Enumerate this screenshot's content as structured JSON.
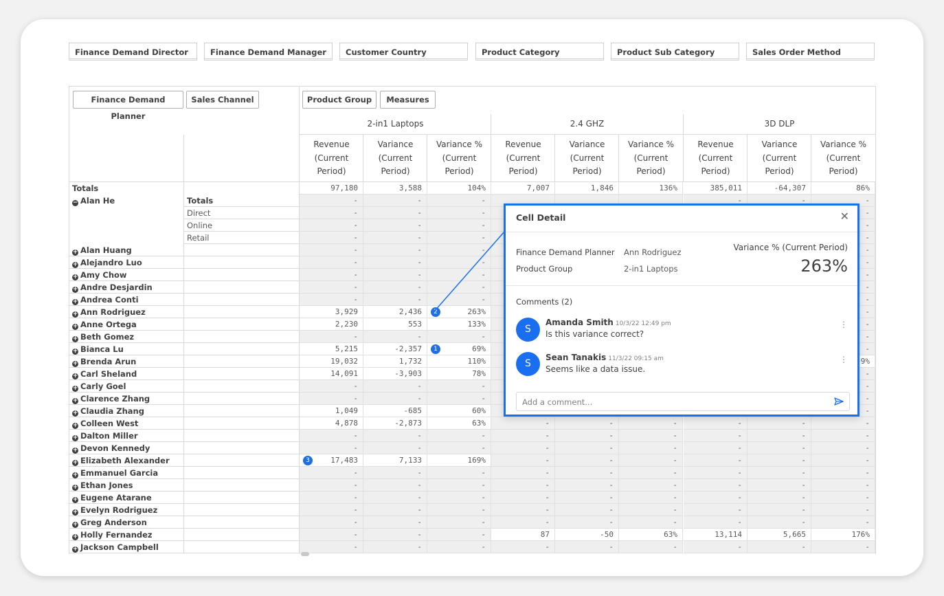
{
  "filters": [
    "Finance Demand Director",
    "Finance Demand Manager",
    "Customer Country",
    "Product Category",
    "Product Sub Category",
    "Sales Order Method"
  ],
  "dimension_buttons": {
    "planner": "Finance Demand Planner",
    "channel": "Sales Channel",
    "group": "Product Group",
    "measures": "Measures"
  },
  "product_groups": [
    "2-in1 Laptops",
    "2.4 GHZ",
    "3D DLP"
  ],
  "measure_header": [
    "Revenue (Current Period)",
    "Variance (Current Period)",
    "Variance % (Current Period)"
  ],
  "measure_lines": [
    [
      "Revenue",
      "(Current",
      "Period)"
    ],
    [
      "Variance",
      "(Current",
      "Period)"
    ],
    [
      "Variance %",
      "(Current",
      "Period)"
    ]
  ],
  "totals": {
    "label": "Totals",
    "values": [
      "97,180",
      "3,588",
      "104%",
      "7,007",
      "1,846",
      "136%",
      "385,011",
      "-64,307",
      "86%"
    ]
  },
  "rows": [
    {
      "name": "Alan He",
      "sub": "Totals",
      "sub_bold": true,
      "expanded": true,
      "vals": [
        "-",
        "-",
        "-",
        "",
        "",
        "",
        "-",
        "-",
        "-"
      ],
      "white": []
    },
    {
      "name": "",
      "sub": "Direct",
      "vals": [
        "-",
        "-",
        "-",
        "",
        "",
        "",
        "",
        "",
        "-"
      ],
      "white": []
    },
    {
      "name": "",
      "sub": "Online",
      "vals": [
        "-",
        "-",
        "-",
        "",
        "",
        "",
        "",
        "",
        "-"
      ],
      "white": []
    },
    {
      "name": "",
      "sub": "Retail",
      "vals": [
        "-",
        "-",
        "-",
        "",
        "",
        "",
        "",
        "",
        "-"
      ],
      "white": []
    },
    {
      "name": "Alan Huang",
      "vals": [
        "-",
        "-",
        "-",
        "",
        "",
        "",
        "",
        "",
        "-"
      ],
      "white": []
    },
    {
      "name": "Alejandro Luo",
      "vals": [
        "-",
        "-",
        "-",
        "",
        "",
        "",
        "",
        "",
        "-"
      ],
      "white": []
    },
    {
      "name": "Amy Chow",
      "vals": [
        "-",
        "-",
        "-",
        "",
        "",
        "",
        "",
        "",
        "-"
      ],
      "white": []
    },
    {
      "name": "Andre Desjardin",
      "vals": [
        "-",
        "-",
        "-",
        "",
        "",
        "",
        "",
        "",
        "-"
      ],
      "white": []
    },
    {
      "name": "Andrea Conti",
      "vals": [
        "-",
        "-",
        "-",
        "",
        "",
        "",
        "",
        "",
        "-"
      ],
      "white": []
    },
    {
      "name": "Ann Rodriguez",
      "vals": [
        "3,929",
        "2,436",
        "263%",
        "",
        "",
        "",
        "",
        "",
        "-"
      ],
      "white": [
        0,
        1,
        2
      ],
      "badge": {
        "col": 2,
        "num": "2"
      }
    },
    {
      "name": "Anne Ortega",
      "vals": [
        "2,230",
        "553",
        "133%",
        "",
        "",
        "",
        "",
        "",
        "-"
      ],
      "white": [
        0,
        1,
        2
      ]
    },
    {
      "name": "Beth Gomez",
      "vals": [
        "-",
        "-",
        "-",
        "",
        "",
        "",
        "",
        "",
        "-"
      ],
      "white": []
    },
    {
      "name": "Bianca Lu",
      "vals": [
        "5,215",
        "-2,357",
        "69%",
        "",
        "",
        "",
        "",
        "",
        "-"
      ],
      "white": [
        0,
        1,
        2
      ],
      "badge": {
        "col": 2,
        "num": "1"
      }
    },
    {
      "name": "Brenda Arun",
      "vals": [
        "19,032",
        "1,732",
        "110%",
        "",
        "",
        "",
        "",
        "",
        "9%"
      ],
      "white": [
        0,
        1,
        2,
        8
      ]
    },
    {
      "name": "Carl Sheland",
      "vals": [
        "14,091",
        "-3,903",
        "78%",
        "",
        "",
        "",
        "",
        "",
        "-"
      ],
      "white": [
        0,
        1,
        2
      ]
    },
    {
      "name": "Carly Goel",
      "vals": [
        "-",
        "-",
        "-",
        "",
        "",
        "",
        "",
        "",
        "-"
      ],
      "white": []
    },
    {
      "name": "Clarence Zhang",
      "vals": [
        "-",
        "-",
        "-",
        "",
        "",
        "",
        "",
        "",
        "-"
      ],
      "white": []
    },
    {
      "name": "Claudia Zhang",
      "vals": [
        "1,049",
        "-685",
        "60%",
        "",
        "",
        "",
        "",
        "",
        "-"
      ],
      "white": [
        0,
        1,
        2
      ]
    },
    {
      "name": "Colleen West",
      "vals": [
        "4,878",
        "-2,873",
        "63%",
        "-",
        "-",
        "-",
        "-",
        "-",
        "-"
      ],
      "white": [
        0,
        1,
        2
      ]
    },
    {
      "name": "Dalton Miller",
      "vals": [
        "-",
        "-",
        "-",
        "-",
        "-",
        "-",
        "-",
        "-",
        "-"
      ],
      "white": []
    },
    {
      "name": "Devon Kennedy",
      "vals": [
        "-",
        "-",
        "-",
        "-",
        "-",
        "-",
        "-",
        "-",
        "-"
      ],
      "white": []
    },
    {
      "name": "Elizabeth Alexander",
      "vals": [
        "17,483",
        "7,133",
        "169%",
        "-",
        "-",
        "-",
        "-",
        "-",
        "-"
      ],
      "white": [
        0,
        1,
        2
      ],
      "badge": {
        "col": 0,
        "num": "3"
      }
    },
    {
      "name": "Emmanuel Garcia",
      "vals": [
        "-",
        "-",
        "-",
        "-",
        "-",
        "-",
        "-",
        "-",
        "-"
      ],
      "white": []
    },
    {
      "name": "Ethan Jones",
      "vals": [
        "-",
        "-",
        "-",
        "-",
        "-",
        "-",
        "-",
        "-",
        "-"
      ],
      "white": []
    },
    {
      "name": "Eugene Atarane",
      "vals": [
        "-",
        "-",
        "-",
        "-",
        "-",
        "-",
        "-",
        "-",
        "-"
      ],
      "white": []
    },
    {
      "name": "Evelyn Rodriguez",
      "vals": [
        "-",
        "-",
        "-",
        "-",
        "-",
        "-",
        "-",
        "-",
        "-"
      ],
      "white": []
    },
    {
      "name": "Greg Anderson",
      "vals": [
        "-",
        "-",
        "-",
        "-",
        "-",
        "-",
        "-",
        "-",
        "-"
      ],
      "white": []
    },
    {
      "name": "Holly Fernandez",
      "vals": [
        "-",
        "-",
        "-",
        "87",
        "-50",
        "63%",
        "13,114",
        "5,665",
        "176%"
      ],
      "white": [
        3,
        4,
        5,
        6,
        7,
        8
      ]
    },
    {
      "name": "Jackson Campbell",
      "vals": [
        "-",
        "-",
        "-",
        "-",
        "-",
        "-",
        "-",
        "-",
        "-"
      ],
      "white": []
    }
  ],
  "popup": {
    "title": "Cell Detail",
    "close_icon": "close-icon",
    "planner_label": "Finance Demand Planner",
    "planner_value": "Ann Rodriguez",
    "group_label": "Product Group",
    "group_value": "2-in1 Laptops",
    "measure_name": "Variance % (Current Period)",
    "measure_value": "263%",
    "comments_title": "Comments (2)",
    "comments": [
      {
        "initial": "S",
        "author": "Amanda Smith",
        "time": "10/3/22 12:49 pm",
        "text": "Is this variance correct?"
      },
      {
        "initial": "S",
        "author": "Sean Tanakis",
        "time": "11/3/22 09:15 am",
        "text": "Seems like a data issue."
      }
    ],
    "input_placeholder": "Add a comment...",
    "send_icon": "send-icon"
  },
  "colors": {
    "accent": "#1a6ff0",
    "gray_cell": "#efefef"
  }
}
